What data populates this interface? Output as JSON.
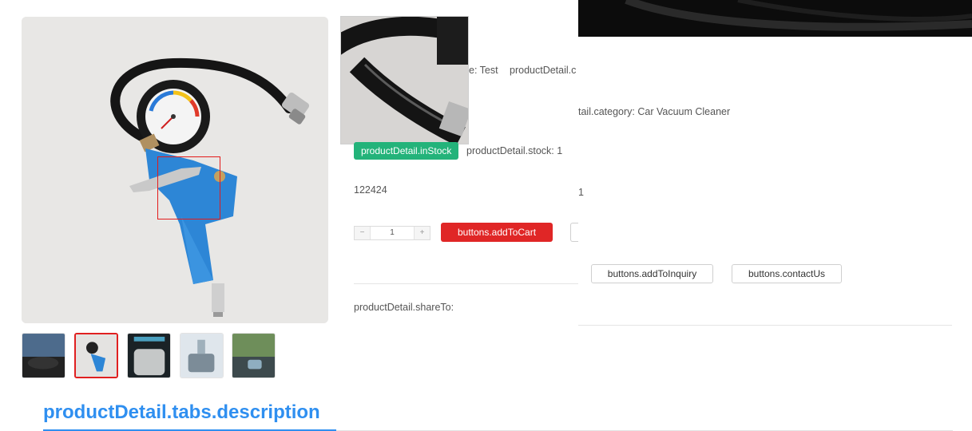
{
  "product": {
    "name_suffix": "e: Test",
    "category_key_fragment": "productDetail.c",
    "category_line": "tail.category: Car Vacuum Cleaner",
    "in_stock_badge": "productDetail.inStock",
    "stock_line": "productDetail.stock: 1",
    "code": "122424",
    "overlay_value": "1",
    "quantity": "1",
    "share_label": "productDetail.shareTo:"
  },
  "buttons": {
    "add_to_cart": "buttons.addToCart",
    "add_to_inquiry": "buttons.addToInquiry",
    "contact_us": "buttons.contactUs",
    "minus": "−",
    "plus": "+"
  },
  "thumbnails": [
    {
      "name": "thumb-car-vacuum",
      "active": false
    },
    {
      "name": "thumb-tire-gauge",
      "active": true
    },
    {
      "name": "thumb-dark-product",
      "active": false
    },
    {
      "name": "thumb-car-interior",
      "active": false
    },
    {
      "name": "thumb-road-scene",
      "active": false
    }
  ],
  "tabs": {
    "description": "productDetail.tabs.description"
  },
  "colors": {
    "accent_red": "#e02626",
    "stock_green": "#23b37a",
    "tab_blue": "#2f8ff0"
  }
}
